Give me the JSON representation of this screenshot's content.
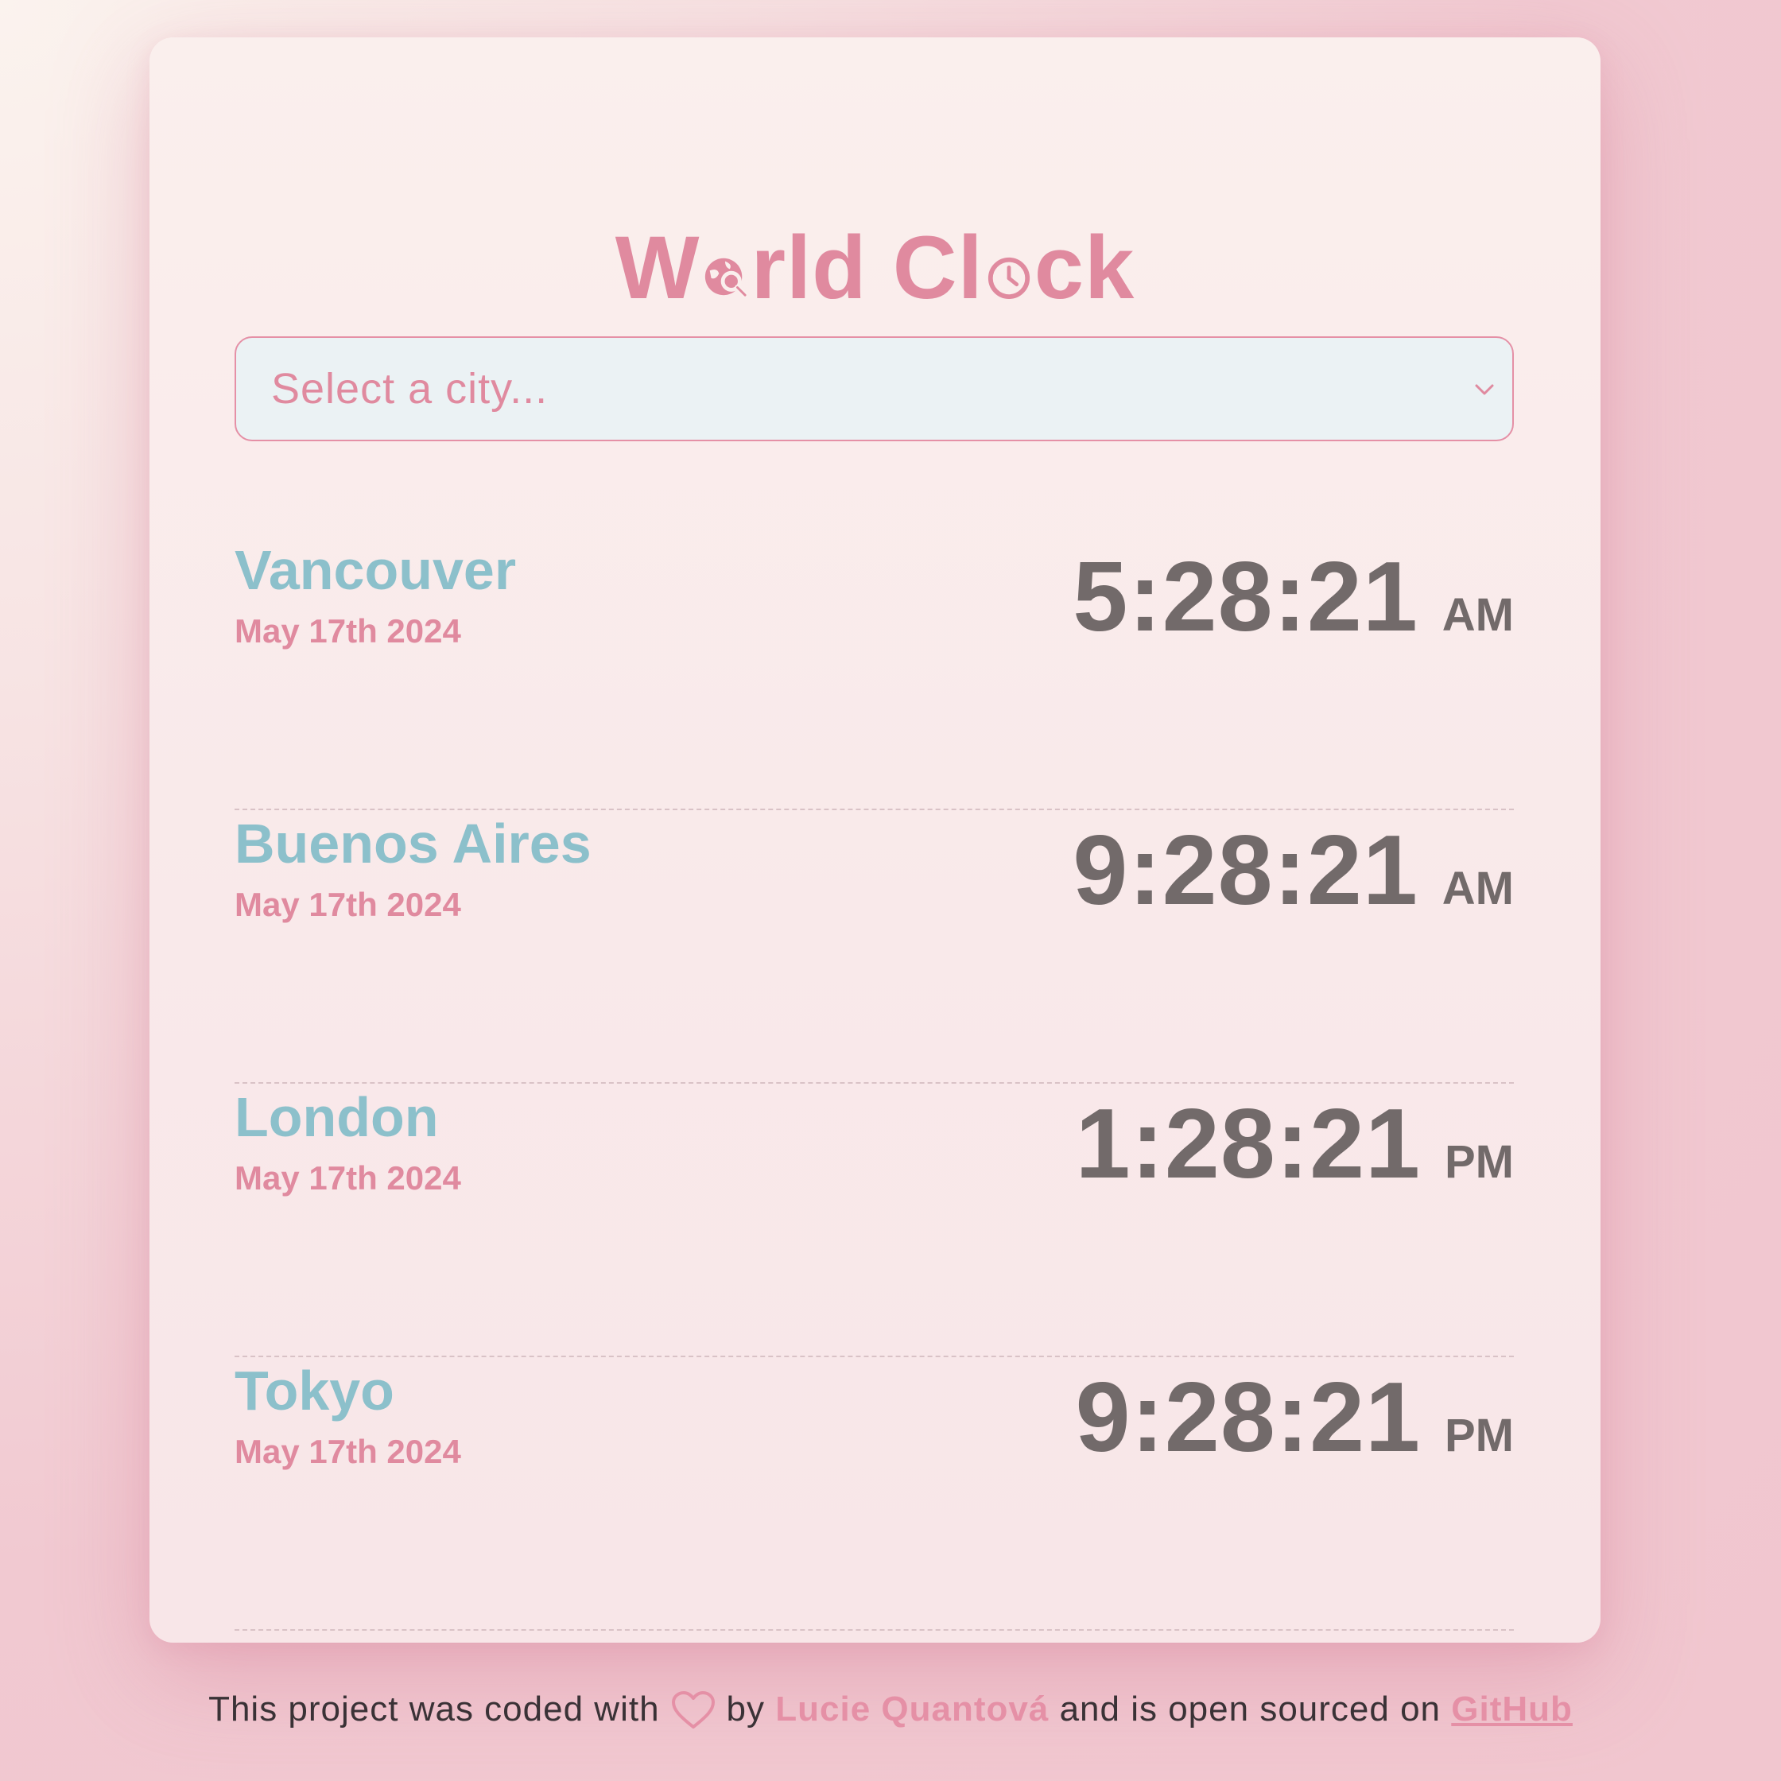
{
  "title": {
    "part1": "W",
    "part2": "rld Cl",
    "part3": "ck",
    "globe_icon": "globe-search-icon",
    "clock_icon": "clock-icon"
  },
  "city_select": {
    "placeholder": "Select a city...",
    "chevron_icon": "chevron-down-icon"
  },
  "cities": [
    {
      "name": "Vancouver",
      "date": "May 17th 2024",
      "time": "5:28:21",
      "ampm": "AM"
    },
    {
      "name": "Buenos Aires",
      "date": "May 17th 2024",
      "time": "9:28:21",
      "ampm": "AM"
    },
    {
      "name": "London",
      "date": "May 17th 2024",
      "time": "1:28:21",
      "ampm": "PM"
    },
    {
      "name": "Tokyo",
      "date": "May 17th 2024",
      "time": "9:28:21",
      "ampm": "PM"
    }
  ],
  "footer": {
    "text_before": "This project was coded with",
    "heart_icon": "heart-icon",
    "by": "by",
    "author": "Lucie Quantová",
    "text_middle": "and is open sourced on",
    "github_link": "GitHub"
  },
  "colors": {
    "accent_pink": "#e08a9f",
    "city_blue": "#8cc0cb",
    "time_gray": "#726a6a",
    "select_bg": "#ebf2f4"
  }
}
